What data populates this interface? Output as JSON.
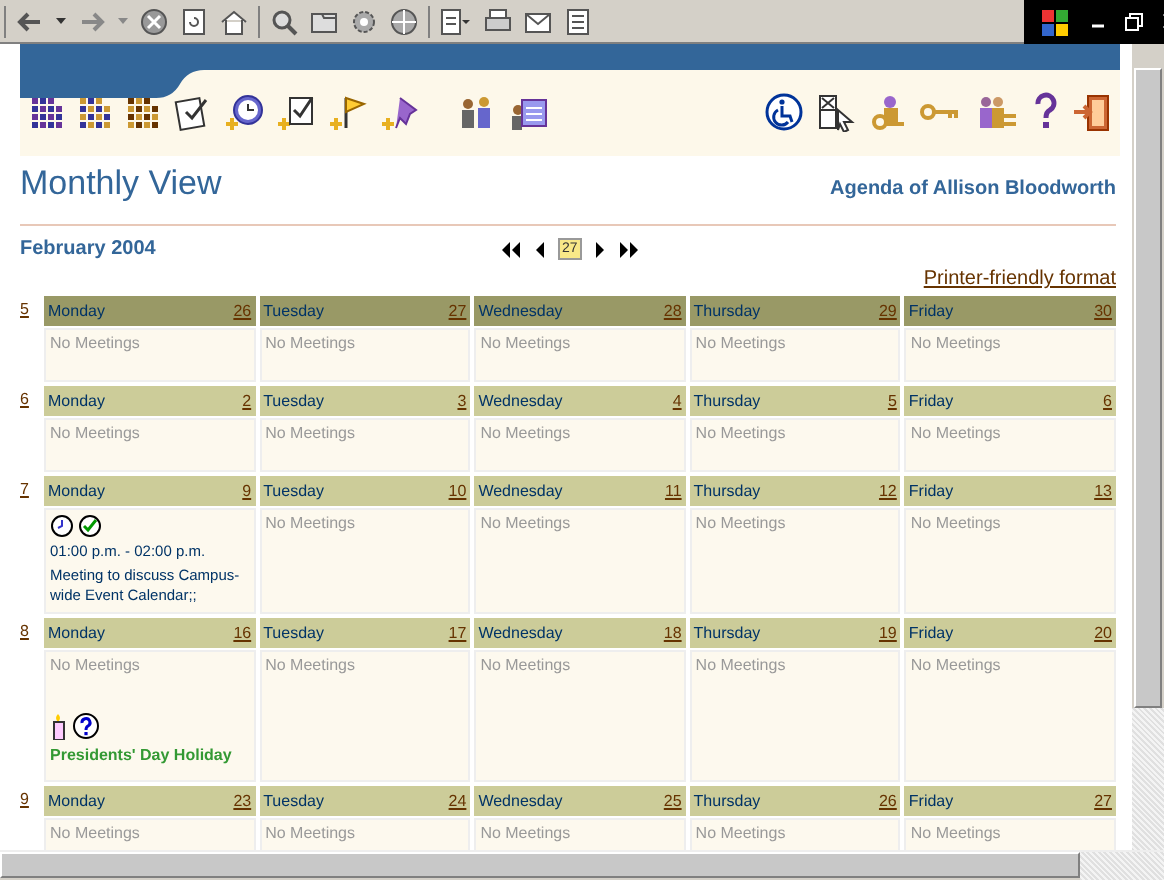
{
  "page": {
    "title": "Monthly View",
    "agenda": "Agenda of Allison Bloodworth",
    "month": "February 2004",
    "today_badge": "27",
    "printer_link": "Printer-friendly format"
  },
  "weeks": [
    {
      "number": "5",
      "days": [
        {
          "weekday": "Monday",
          "date": "26",
          "other_month": true,
          "note": "No Meetings"
        },
        {
          "weekday": "Tuesday",
          "date": "27",
          "other_month": true,
          "note": "No Meetings"
        },
        {
          "weekday": "Wednesday",
          "date": "28",
          "other_month": true,
          "note": "No Meetings"
        },
        {
          "weekday": "Thursday",
          "date": "29",
          "other_month": true,
          "note": "No Meetings"
        },
        {
          "weekday": "Friday",
          "date": "30",
          "other_month": true,
          "note": "No Meetings"
        }
      ]
    },
    {
      "number": "6",
      "days": [
        {
          "weekday": "Monday",
          "date": "2",
          "other_month": false,
          "note": "No Meetings"
        },
        {
          "weekday": "Tuesday",
          "date": "3",
          "other_month": false,
          "note": "No Meetings"
        },
        {
          "weekday": "Wednesday",
          "date": "4",
          "other_month": false,
          "note": "No Meetings"
        },
        {
          "weekday": "Thursday",
          "date": "5",
          "other_month": false,
          "note": "No Meetings"
        },
        {
          "weekday": "Friday",
          "date": "6",
          "other_month": false,
          "note": "No Meetings"
        }
      ]
    },
    {
      "number": "7",
      "days": [
        {
          "weekday": "Monday",
          "date": "9",
          "other_month": false,
          "events": [
            {
              "kind": "meeting",
              "time": "01:00 p.m. - 02:00 p.m.",
              "title": "Meeting to discuss Campus-wide Event Calendar;;"
            }
          ]
        },
        {
          "weekday": "Tuesday",
          "date": "10",
          "other_month": false,
          "note": "No Meetings"
        },
        {
          "weekday": "Wednesday",
          "date": "11",
          "other_month": false,
          "note": "No Meetings"
        },
        {
          "weekday": "Thursday",
          "date": "12",
          "other_month": false,
          "note": "No Meetings"
        },
        {
          "weekday": "Friday",
          "date": "13",
          "other_month": false,
          "note": "No Meetings"
        }
      ]
    },
    {
      "number": "8",
      "days": [
        {
          "weekday": "Monday",
          "date": "16",
          "other_month": false,
          "note": "No Meetings",
          "events": [
            {
              "kind": "holiday",
              "title": "Presidents' Day Holiday"
            }
          ]
        },
        {
          "weekday": "Tuesday",
          "date": "17",
          "other_month": false,
          "note": "No Meetings"
        },
        {
          "weekday": "Wednesday",
          "date": "18",
          "other_month": false,
          "note": "No Meetings"
        },
        {
          "weekday": "Thursday",
          "date": "19",
          "other_month": false,
          "note": "No Meetings"
        },
        {
          "weekday": "Friday",
          "date": "20",
          "other_month": false,
          "note": "No Meetings"
        }
      ]
    },
    {
      "number": "9",
      "days": [
        {
          "weekday": "Monday",
          "date": "23",
          "other_month": false,
          "note": "No Meetings"
        },
        {
          "weekday": "Tuesday",
          "date": "24",
          "other_month": false,
          "note": "No Meetings"
        },
        {
          "weekday": "Wednesday",
          "date": "25",
          "other_month": false,
          "note": "No Meetings"
        },
        {
          "weekday": "Thursday",
          "date": "26",
          "other_month": false,
          "note": "No Meetings"
        },
        {
          "weekday": "Friday",
          "date": "27",
          "other_month": false,
          "note": "No Meetings"
        }
      ]
    }
  ]
}
